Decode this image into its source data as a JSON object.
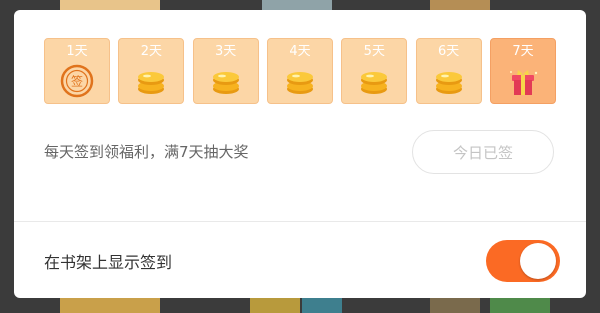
{
  "checkin": {
    "days": [
      {
        "label": "1天",
        "icon": "sign-stamp-icon"
      },
      {
        "label": "2天",
        "icon": "coins-icon"
      },
      {
        "label": "3天",
        "icon": "coins-icon"
      },
      {
        "label": "4天",
        "icon": "coins-icon"
      },
      {
        "label": "5天",
        "icon": "coins-icon"
      },
      {
        "label": "6天",
        "icon": "coins-icon"
      },
      {
        "label": "7天",
        "icon": "gift-icon"
      }
    ],
    "stamp_text": "签",
    "promo_text": "每天签到领福利，满7天抽大奖",
    "signed_button": "今日已签"
  },
  "settings": {
    "shelf_label": "在书架上显示签到",
    "shelf_toggle_on": true
  },
  "colors": {
    "accent": "#fb6a24",
    "day_bg": "#fcd6a6",
    "final_day_bg": "#fbb378",
    "coin": "#f7b21f"
  }
}
